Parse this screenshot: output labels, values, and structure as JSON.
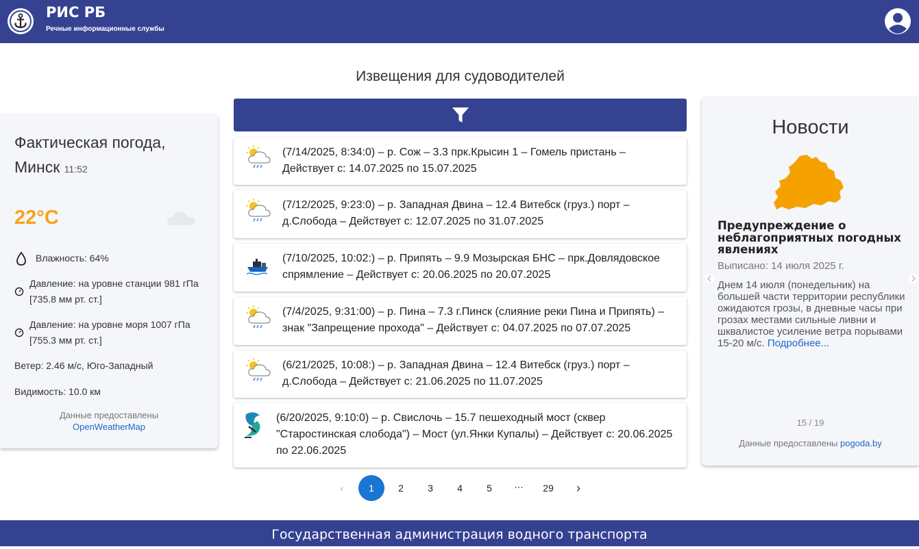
{
  "header": {
    "title": "РИС РБ",
    "subtitle": "Речные информационные службы"
  },
  "page_heading": "Извещения для судоводителей",
  "weather": {
    "title": "Фактическая погода, Минск",
    "time": "11:52",
    "temperature": "22°C",
    "humidity": "Влажность: 64%",
    "pressure_station": "Давление: на уровне станции 981 гПа [735.8 мм рт. ст.]",
    "pressure_sea": "Давление: на уровне моря 1007 гПа [755.3 мм рт. ст.]",
    "wind": "Ветер: 2.46 м/с, Юго-Западный",
    "visibility": "Видимость: 10.0 км",
    "source_text": "Данные предоставлены",
    "source_link": "OpenWeatherMap"
  },
  "notices": [
    {
      "icon": "sun-rain-cloud-icon",
      "text": "(7/14/2025, 8:34:0) – р. Сож – 3.3 прк.Крысин 1 – Гомель пристань – Действует с: 14.07.2025 по 15.07.2025"
    },
    {
      "icon": "sun-rain-cloud-icon",
      "text": "(7/12/2025, 9:23:0) – р. Западная Двина – 12.4 Витебск (груз.) порт – д.Слобода – Действует с: 12.07.2025 по 31.07.2025"
    },
    {
      "icon": "ship-icon",
      "text": "(7/10/2025, 10:02:) – р. Припять – 9.9 Мозырская БНС – прк.Довлядовское спрямление – Действует с: 20.06.2025 по 20.07.2025"
    },
    {
      "icon": "sun-rain-cloud-icon",
      "text": "(7/4/2025, 9:31:00) – р. Пина – 7.3 г.Пинск (слияние реки Пина и Припять) – знак \"Запрещение прохода\" – Действует с: 04.07.2025 по 07.07.2025"
    },
    {
      "icon": "sun-rain-cloud-icon",
      "text": "(6/21/2025, 10:08:) – р. Западная Двина – 12.4 Витебск (груз.) порт – д.Слобода – Действует с: 21.06.2025 по 11.07.2025"
    },
    {
      "icon": "waves-icon",
      "text": "(6/20/2025, 9:10:0) – р. Свислочь – 15.7 пешеходный мост (сквер \"Старостинская слобода\") – Мост (ул.Янки Купалы) – Действует с: 20.06.2025 по 22.06.2025"
    }
  ],
  "pagination": {
    "pages": [
      "1",
      "2",
      "3",
      "4",
      "5",
      "…",
      "29"
    ],
    "current": "1"
  },
  "news": {
    "title": "Новости",
    "headline": "Предупреждение о неблагоприятных погодных явлениях",
    "date": "Выписано: 14 июля 2025 г.",
    "body": "Днем 14 июля (понедельник) на большей части территории республики ожидаются грозы, в дневные часы при грозах местами сильные ливни и шквалистое усиление ветра порывами 15-20 м/с.",
    "more_link": "Подробнее...",
    "counter": "15 / 19",
    "source_text": "Данные предоставлены",
    "source_link": "pogoda.by",
    "map_color": "#f5a100"
  },
  "footer": "Государственная администрация водного транспорта",
  "colors": {
    "brand": "#354292",
    "accent_orange": "#f7a21b",
    "pager_active": "#1976d2",
    "link": "#1e66c8"
  }
}
